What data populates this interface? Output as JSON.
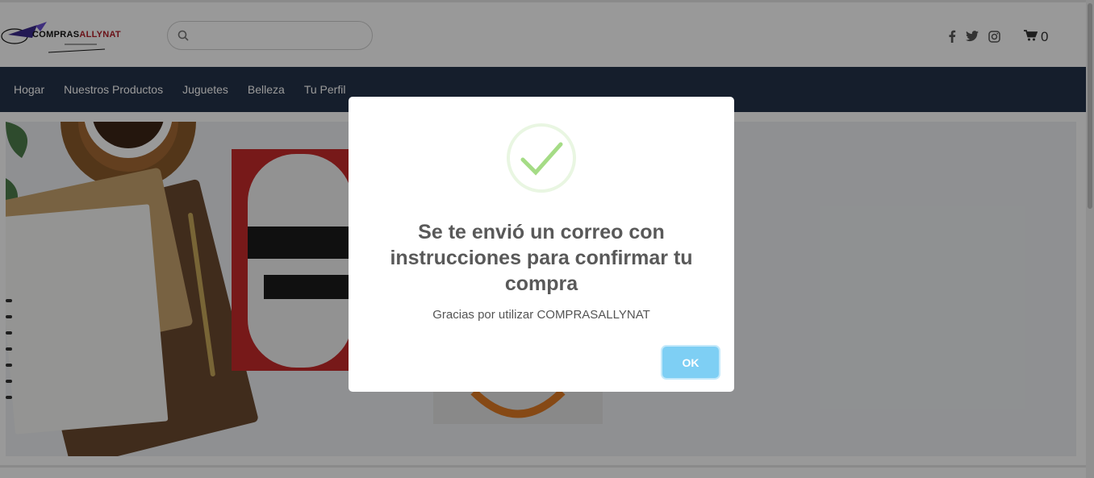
{
  "header": {
    "logo_text_left": "COMPRAS",
    "logo_text_right": "ALLYNAT",
    "search": {
      "placeholder": "",
      "value": ""
    },
    "social": [
      "facebook-icon",
      "twitter-icon",
      "instagram-icon"
    ],
    "cart_count": "0"
  },
  "nav": {
    "items": [
      {
        "label": "Hogar"
      },
      {
        "label": "Nuestros Productos"
      },
      {
        "label": "Juguetes"
      },
      {
        "label": "Belleza"
      },
      {
        "label": "Tu Perfil"
      }
    ]
  },
  "modal": {
    "icon": "success-check-icon",
    "title": "Se te envió un correo con instrucciones para confirmar tu compra",
    "text": "Gracias por utilizar COMPRASALLYNAT",
    "ok_label": "OK"
  },
  "colors": {
    "nav_bg": "#24324a",
    "ok_button": "#7ecff4",
    "check": "#a5dc86"
  }
}
